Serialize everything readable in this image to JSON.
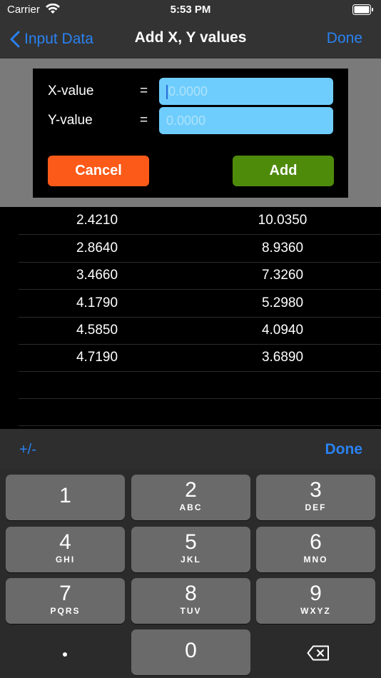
{
  "status_bar": {
    "carrier": "Carrier",
    "time": "5:53 PM"
  },
  "nav": {
    "back_label": "Input Data",
    "title": "Add X, Y values",
    "done_label": "Done"
  },
  "form": {
    "x_label": "X-value",
    "y_label": "Y-value",
    "equals": "=",
    "x_placeholder": "0.0000",
    "y_placeholder": "0.0000",
    "cancel_label": "Cancel",
    "add_label": "Add"
  },
  "table": {
    "rows": [
      {
        "x": "2.4210",
        "y": "10.0350"
      },
      {
        "x": "2.8640",
        "y": "8.9360"
      },
      {
        "x": "3.4660",
        "y": "7.3260"
      },
      {
        "x": "4.1790",
        "y": "5.2980"
      },
      {
        "x": "4.5850",
        "y": "4.0940"
      },
      {
        "x": "4.7190",
        "y": "3.6890"
      }
    ]
  },
  "accessory": {
    "plus_minus": "+/-",
    "done_label": "Done"
  },
  "keypad": {
    "keys": [
      {
        "num": "1",
        "letters": ""
      },
      {
        "num": "2",
        "letters": "ABC"
      },
      {
        "num": "3",
        "letters": "DEF"
      },
      {
        "num": "4",
        "letters": "GHI"
      },
      {
        "num": "5",
        "letters": "JKL"
      },
      {
        "num": "6",
        "letters": "MNO"
      },
      {
        "num": "7",
        "letters": "PQRS"
      },
      {
        "num": "8",
        "letters": "TUV"
      },
      {
        "num": "9",
        "letters": "WXYZ"
      },
      {
        "num": "0",
        "letters": ""
      }
    ],
    "dot_icon": "decimal-point-icon",
    "backspace_icon": "backspace-icon"
  },
  "colors": {
    "accent": "#2a82f0",
    "field": "#6ecdfc",
    "cancel": "#fb5a19",
    "add": "#4f8b0b"
  }
}
